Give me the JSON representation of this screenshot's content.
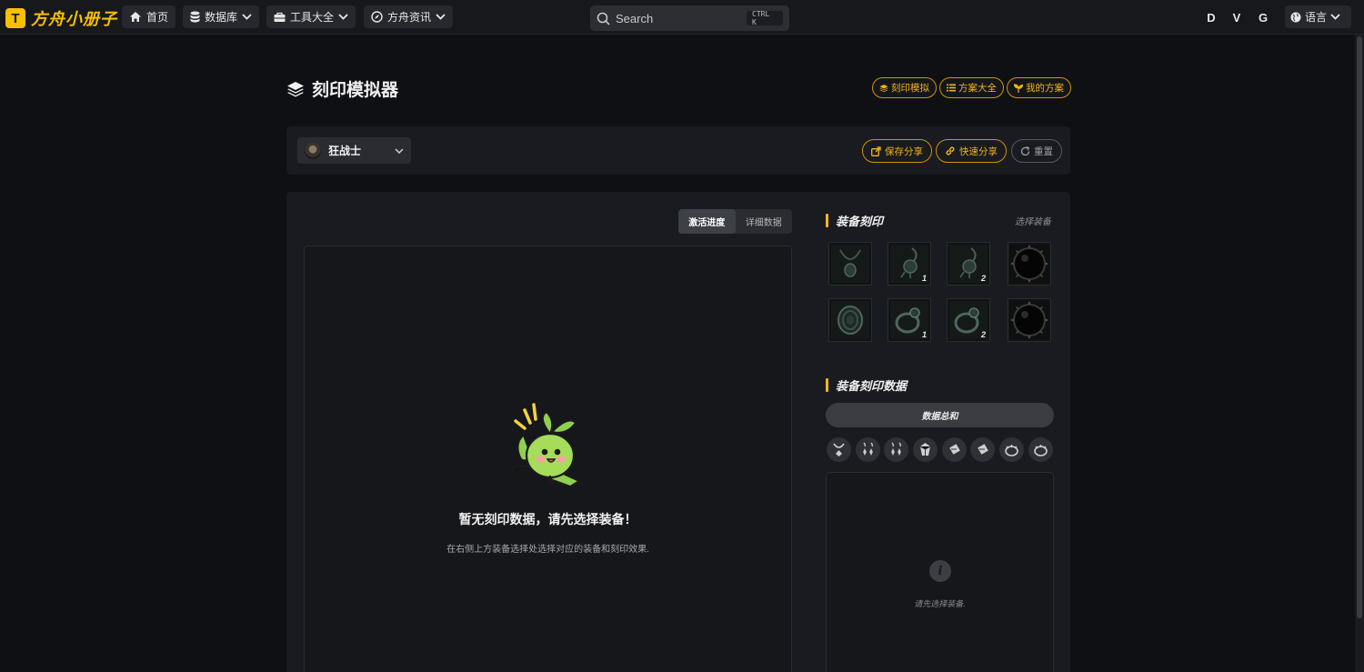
{
  "nav": {
    "logo_text": "方舟小册子",
    "logo_mark": "T",
    "home": "首页",
    "database": "数据库",
    "tools": "工具大全",
    "news": "方舟资讯",
    "search_placeholder": "Search",
    "search_shortcut": "CTRL K",
    "user_letters": [
      "D",
      "V",
      "G"
    ],
    "language": "语言"
  },
  "page": {
    "title": "刻印模拟器",
    "pills": [
      "刻印模拟",
      "方案大全",
      "我的方案"
    ]
  },
  "toolbar": {
    "class_name": "狂战士",
    "save_share": "保存分享",
    "quick_share": "快速分享",
    "reset": "重置"
  },
  "left": {
    "tabs": [
      "激活进度",
      "详细数据"
    ],
    "active_tab": "激活进度",
    "empty_title": "暂无刻印数据，请先选择装备！",
    "empty_sub": "在右侧上方装备选择处选择对应的装备和刻印效果."
  },
  "right": {
    "equip_heading": "装备刻印",
    "select_equip": "选择装备",
    "slots": [
      {
        "icon": "necklace-icon",
        "num": ""
      },
      {
        "icon": "earring-icon",
        "num": "1"
      },
      {
        "icon": "earring-icon",
        "num": "2"
      },
      {
        "icon": "stone-icon",
        "num": ""
      },
      {
        "icon": "bracelet-icon",
        "num": ""
      },
      {
        "icon": "ring-icon",
        "num": "1"
      },
      {
        "icon": "ring-icon",
        "num": "2"
      },
      {
        "icon": "stone-icon",
        "num": ""
      }
    ],
    "data_heading": "装备刻印数据",
    "sum_button": "数据总和",
    "category_icons": [
      "necklace-icon",
      "earring-icon",
      "earring-icon",
      "gem-icon",
      "ring-icon",
      "ring-icon",
      "bracelet-icon",
      "bracelet-icon"
    ],
    "detail_text": "请先选择装备."
  },
  "colors": {
    "accent": "#f0b41c",
    "background": "#0f1014",
    "panel": "#1a1b20"
  }
}
